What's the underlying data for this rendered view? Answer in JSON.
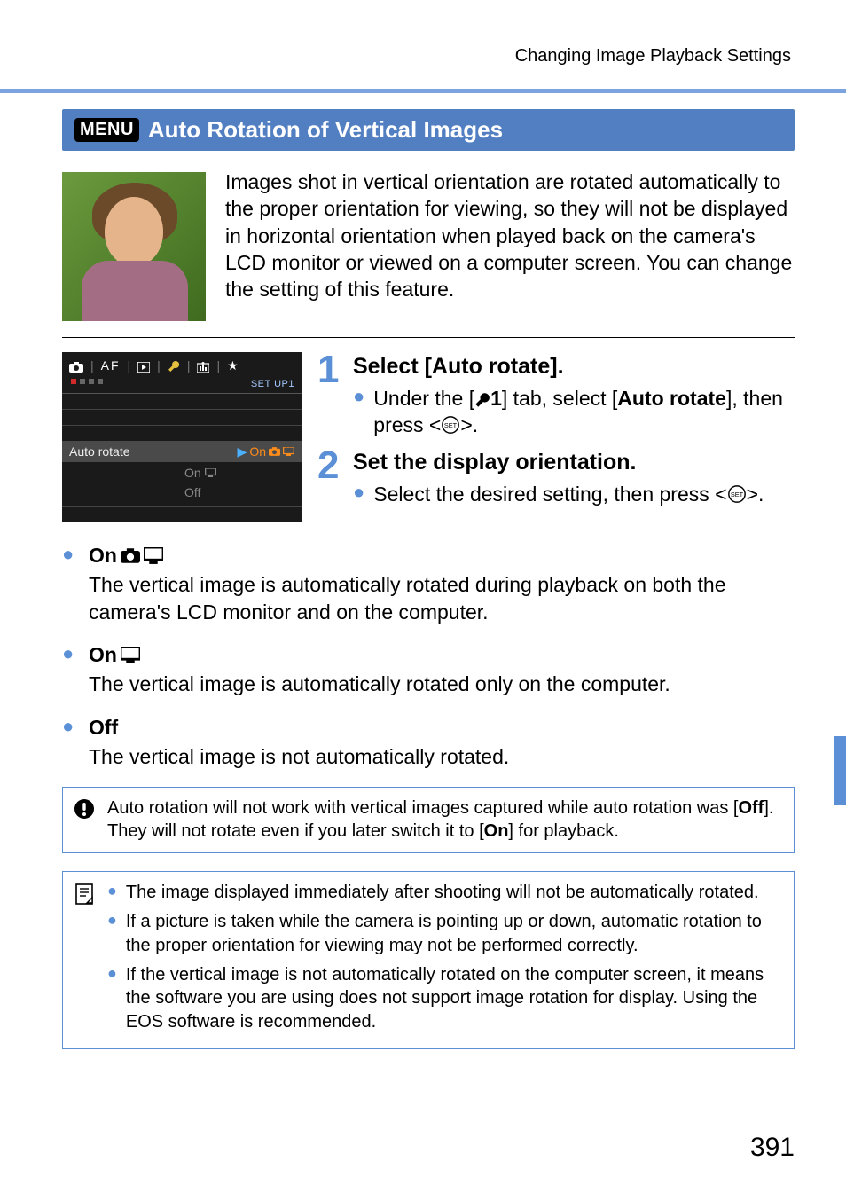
{
  "header": {
    "breadcrumb": "Changing Image Playback Settings"
  },
  "section": {
    "menu_badge": "MENU",
    "title": "Auto Rotation of Vertical Images"
  },
  "intro": "Images shot in vertical orientation are rotated automatically to the proper orientation for viewing, so they will not be displayed in horizontal orientation when played back on the camera's LCD monitor or viewed on a computer screen. You can change the setting of this feature.",
  "camera_screen": {
    "setup_label": "SET UP1",
    "row_label": "Auto rotate",
    "row_value": "On",
    "opt2": "On",
    "opt3": "Off"
  },
  "steps": [
    {
      "num": "1",
      "title": "Select [Auto rotate].",
      "bullet_pre": "Under the [",
      "bullet_mid": "1",
      "bullet_post1": "] tab, select [",
      "bullet_bold": "Auto rotate",
      "bullet_post2": "], then press <",
      "bullet_post3": ">."
    },
    {
      "num": "2",
      "title": "Set the display orientation.",
      "bullet_text_a": "Select the desired setting, then press <",
      "bullet_text_b": ">."
    }
  ],
  "options": [
    {
      "label_prefix": "On",
      "icons": [
        "camera",
        "monitor"
      ],
      "desc": "The vertical image is automatically rotated during playback on both the camera's LCD monitor and on the computer."
    },
    {
      "label_prefix": "On",
      "icons": [
        "monitor"
      ],
      "desc": "The vertical image is automatically rotated only on the computer."
    },
    {
      "label_prefix": "Off",
      "icons": [],
      "desc": "The vertical image is not automatically rotated."
    }
  ],
  "caution": {
    "text_a": "Auto rotation will not work with vertical images captured while auto rotation was [",
    "bold_a": "Off",
    "text_b": "]. They will not rotate even if you later switch it to [",
    "bold_b": "On",
    "text_c": "] for playback."
  },
  "tips": [
    "The image displayed immediately after shooting will not be automatically rotated.",
    "If a picture is taken while the camera is pointing up or down, automatic rotation to the proper orientation for viewing may not be performed correctly.",
    "If the vertical image is not automatically rotated on the computer screen, it means the software you are using does not support image rotation for display. Using the EOS software is recommended."
  ],
  "page_number": "391"
}
